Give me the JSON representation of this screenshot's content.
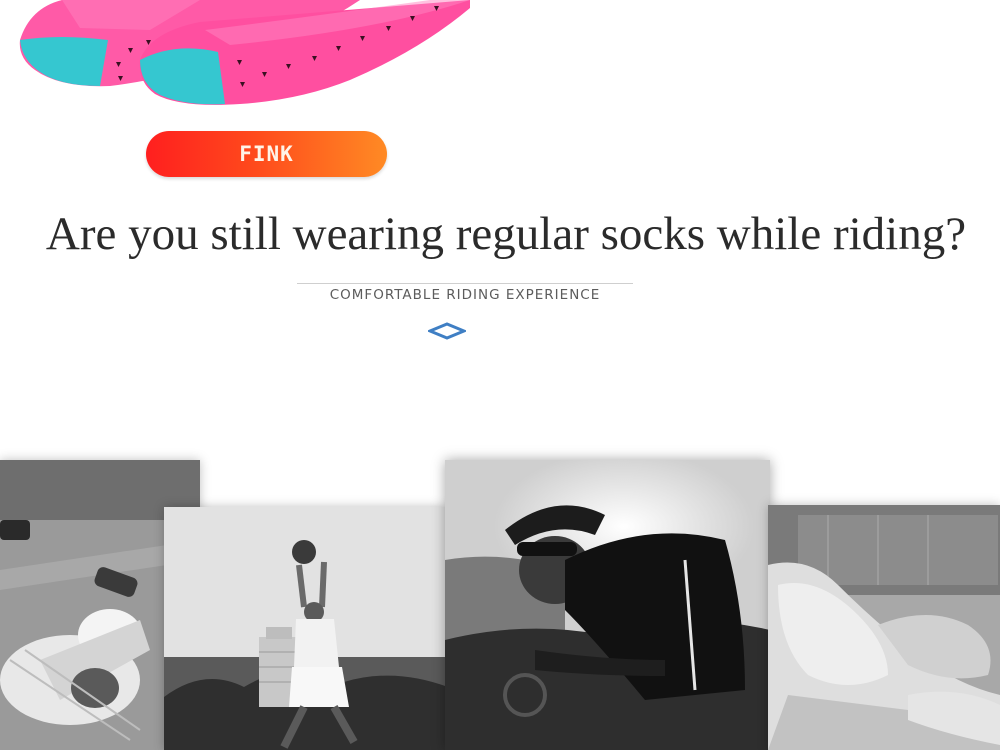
{
  "product": {
    "image_name": "pink-cycling-socks",
    "color_badge": "FINK"
  },
  "headline": "Are you still wearing regular socks while riding?",
  "subtitle": "COMFORTABLE RIDING EXPERIENCE",
  "decor": {
    "divider_icon": "diamond-outline-icon",
    "accent_color": "#3f7fc4"
  },
  "collage": {
    "photos": [
      {
        "name": "baseball-player-photo"
      },
      {
        "name": "basketball-player-photo"
      },
      {
        "name": "cyclist-photo"
      },
      {
        "name": "foot-massage-photo"
      }
    ]
  },
  "colors": {
    "sock_pink": "#ff5aa7",
    "sock_toe": "#35c7d0",
    "badge_start": "#ff1f1f",
    "badge_end": "#ff8a24"
  }
}
